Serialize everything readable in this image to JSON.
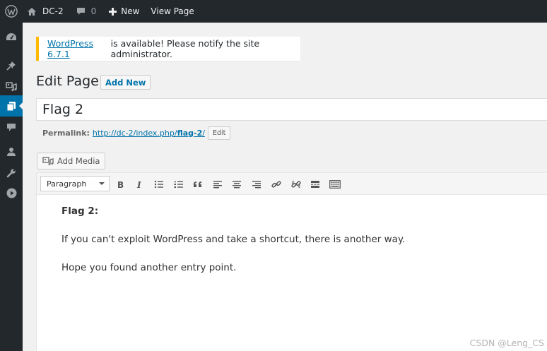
{
  "adminbar": {
    "site_name": "DC-2",
    "comment_count": "0",
    "new_label": "New",
    "view_page_label": "View Page"
  },
  "notice": {
    "link_text": "WordPress 6.7.1",
    "message": " is available! Please notify the site administrator."
  },
  "page": {
    "title": "Edit Page",
    "add_new_label": "Add New"
  },
  "post": {
    "title_value": "Flag 2",
    "permalink_label": "Permalink:",
    "permalink_base": "http://dc-2/index.php/",
    "permalink_slug": "flag-2",
    "permalink_trailing": "/",
    "edit_label": "Edit"
  },
  "media": {
    "add_media_label": "Add Media"
  },
  "toolbar": {
    "format_value": "Paragraph",
    "buttons": [
      "bold",
      "italic",
      "bulleted-list",
      "numbered-list",
      "blockquote",
      "align-left",
      "align-center",
      "align-right",
      "insert-link",
      "remove-link",
      "read-more",
      "toolbar-toggle"
    ]
  },
  "content": {
    "heading": "Flag 2:",
    "para1": "If you can't exploit WordPress and take a shortcut, there is another way.",
    "para2": "Hope you found another entry point."
  },
  "watermark": "CSDN @Leng_CS",
  "colors": {
    "adminbar_bg": "#23282d",
    "accent": "#0073aa",
    "notice_border": "#ffb900"
  }
}
